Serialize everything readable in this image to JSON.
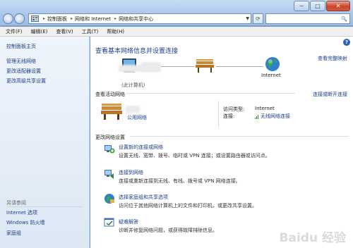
{
  "window": {
    "min_label": "─",
    "max_label": "□",
    "close_label": "✕"
  },
  "nav": {
    "back_label": "◀",
    "forward_label": "▶"
  },
  "address": {
    "crumbs": [
      "控制面板",
      "网络和 Internet",
      "网络和共享中心"
    ],
    "separator": "▸",
    "refresh_label": "⟳",
    "search_icon": "🔍"
  },
  "menu": {
    "items": [
      "文件(F)",
      "编辑(E)",
      "查看(V)",
      "工具(T)",
      "帮助(H)"
    ]
  },
  "sidebar": {
    "links": [
      "控制面板主页",
      "管理无线网络",
      "更改适配器设置",
      "更改高级共享设置"
    ],
    "see_also_title": "另请参阅",
    "see_also": [
      "Internet 选项",
      "Windows 防火墙",
      "家庭组"
    ]
  },
  "main": {
    "help_label": "?",
    "title": "查看基本网络信息并设置连接",
    "full_map": "查看完整映射",
    "map": {
      "node1_label": "(此计算机)",
      "node3_label": "Internet"
    },
    "active_section": "查看活动网络",
    "connect_disconnect": "连接或断开连接",
    "active_network": {
      "subtitle": "公用网络",
      "access_label": "访问类型:",
      "access_value": "Internet",
      "connection_label": "连接:",
      "connection_value": "无线网络连接"
    },
    "change_section": "更改网络设置",
    "tasks": [
      {
        "title": "设置新的连接或网络",
        "desc": "设置无线、宽带、拨号、临时或 VPN 连接；或设置路由器或访问点。"
      },
      {
        "title": "连接到网络",
        "desc": "连接或重新连接到无线、有线、拨号或 VPN 网络连接。"
      },
      {
        "title": "选择家庭组和共享选项",
        "desc": "访问位于其他网络计算机上的文件和打印机，或更改共享设置。"
      },
      {
        "title": "疑难解答",
        "desc": "诊断并修复网络问题，或获得故障排除信息。"
      }
    ],
    "watermark": "Baidu 经验"
  },
  "colors": {
    "link": "#1a3e87",
    "title": "#1e3d8f",
    "sidebar_bg": "#e6eef8"
  }
}
